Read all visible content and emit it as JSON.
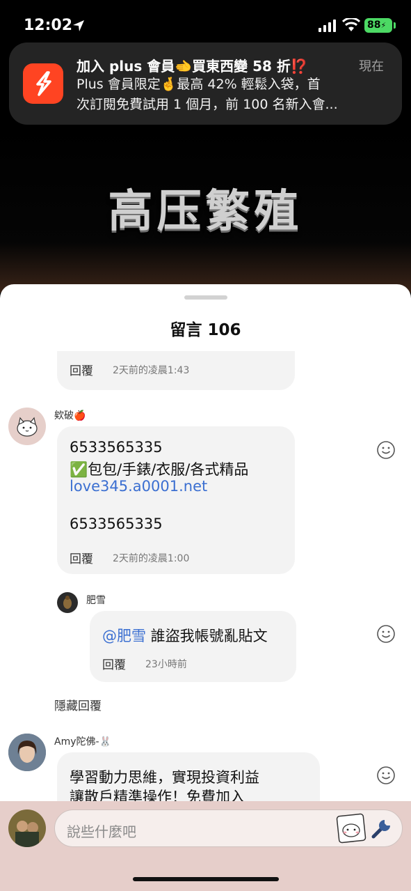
{
  "status": {
    "time": "12:02",
    "battery": "88"
  },
  "notification": {
    "title": "加入 plus 會員🫲買東西變 58 折⁉️",
    "time": "現在",
    "body_line1": "Plus 會員限定🤞最高 42% 輕鬆入袋，首",
    "body_line2": "次訂閱免費試用 1 個月，前 100 名新入會..."
  },
  "video": {
    "overlay_title": "高压繁殖"
  },
  "comments_sheet": {
    "title": "留言 106",
    "reply_label": "回覆",
    "comments": [
      {
        "timestamp": "2天前的凌晨1:43"
      },
      {
        "username": "欸破🍎",
        "lines": [
          "6533565335",
          "✅包包/手錶/衣服/各式精品",
          "love345.a0001.net",
          "",
          "6533565335"
        ],
        "timestamp": "2天前的凌晨1:00"
      },
      {
        "username": "肥雪",
        "mention": "@肥雪",
        "text": " 誰盜我帳號亂貼文",
        "timestamp": "23小時前"
      },
      {
        "username": "Amy陀佛-🐰",
        "lines": [
          "學習動力思維，實現投資利益",
          "讓散戶精準操作！免費加入"
        ]
      }
    ],
    "hide_replies_label": "隱藏回覆"
  },
  "composer": {
    "placeholder": "說些什麼吧"
  },
  "colors": {
    "link": "#3b6fd1",
    "composer_bg": "#e6ceca",
    "battery": "#4cd964",
    "app_icon": "#ff4422"
  }
}
